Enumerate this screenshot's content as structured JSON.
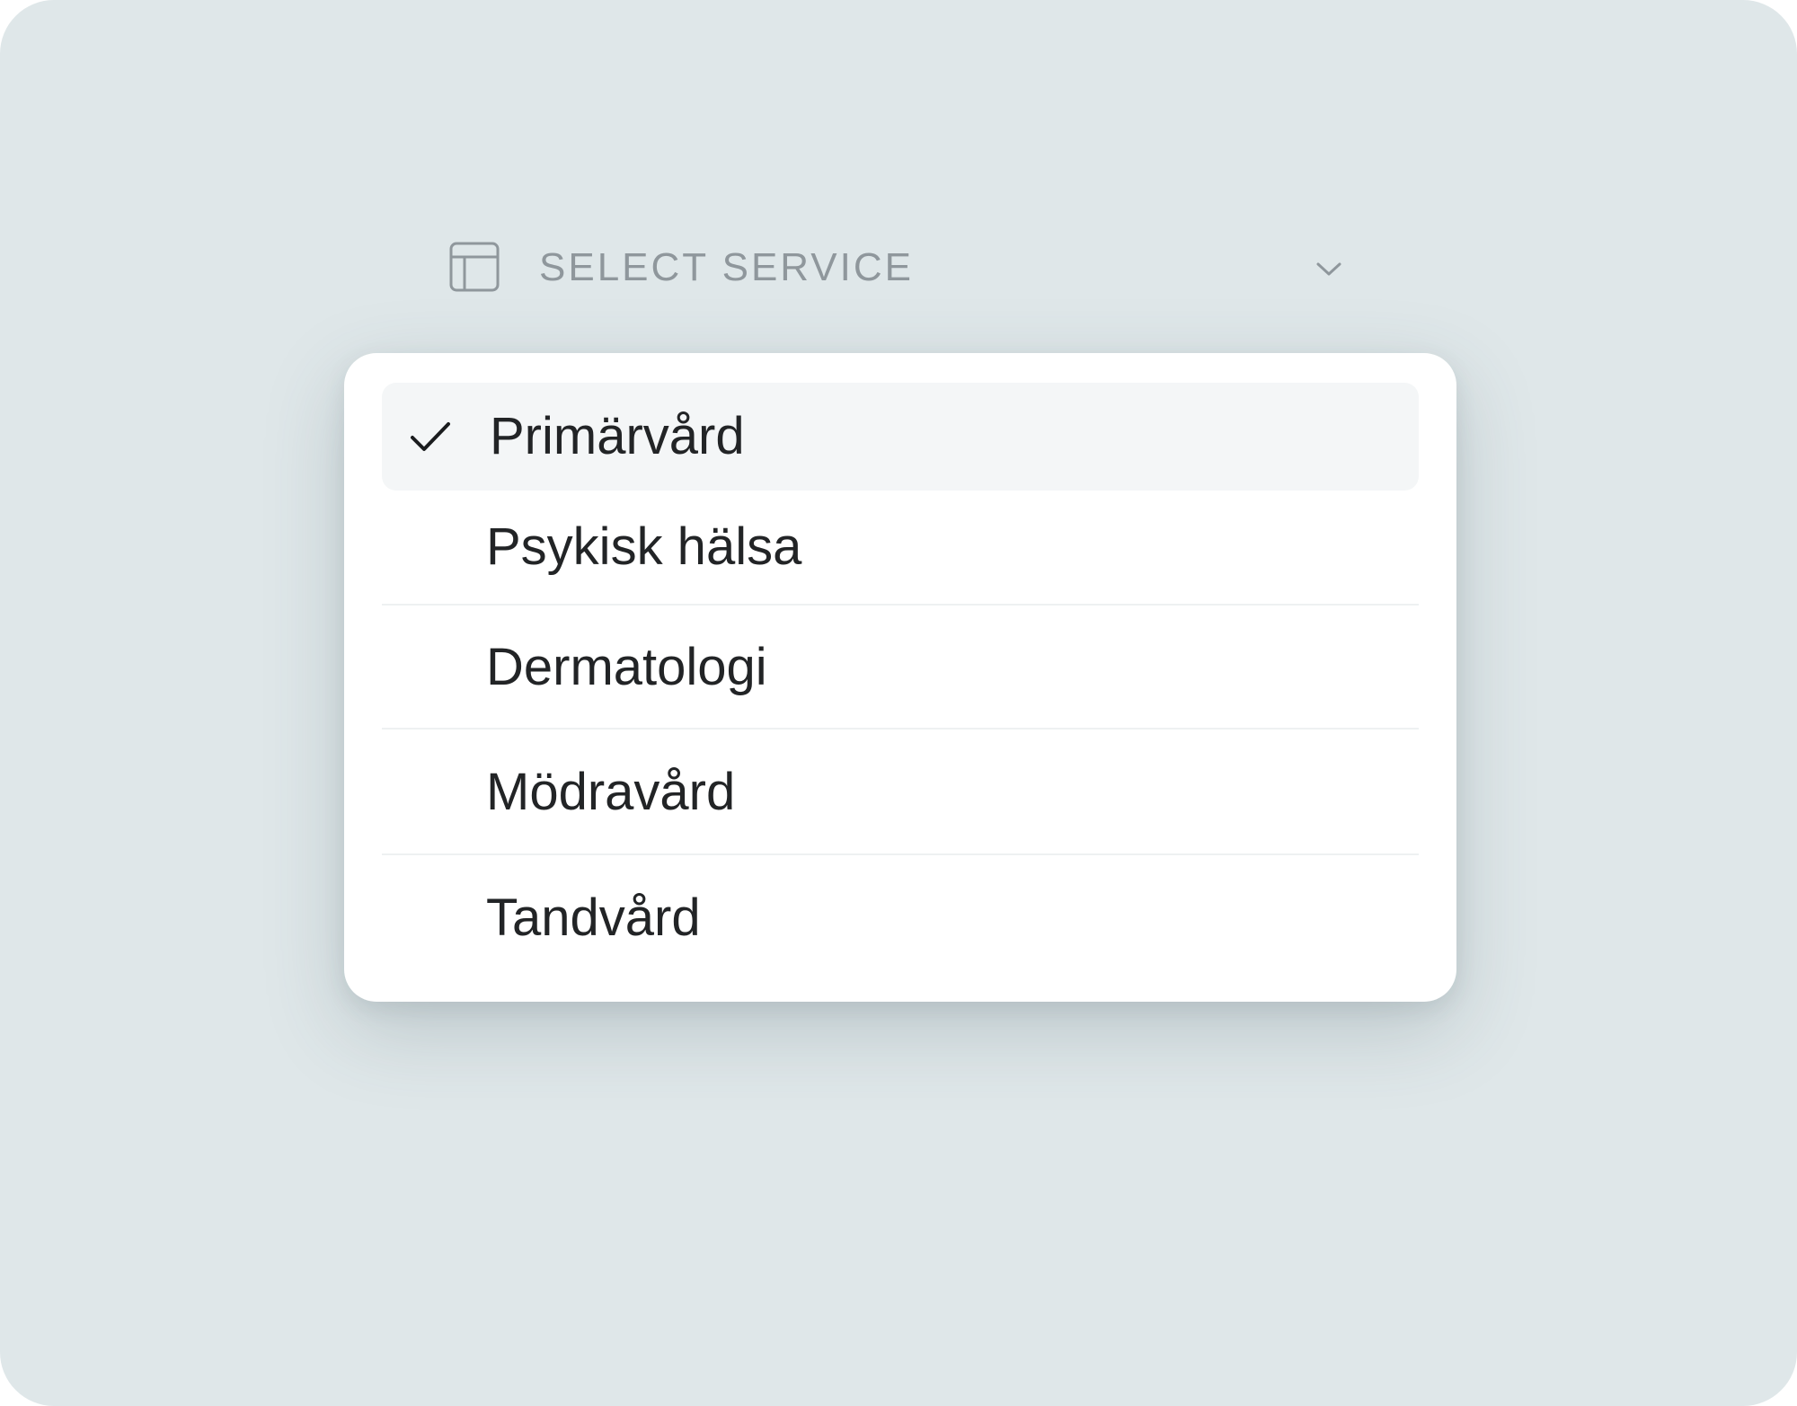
{
  "select": {
    "placeholder": "SELECT SERVICE",
    "icon": "table-layout-icon",
    "chevron": "chevron-down-icon",
    "selected_value": "Primärvård"
  },
  "options": [
    {
      "label": "Primärvård",
      "selected": true
    },
    {
      "label": "Psykisk hälsa",
      "selected": false
    },
    {
      "label": "Dermatologi",
      "selected": false
    },
    {
      "label": "Mödravård",
      "selected": false
    },
    {
      "label": "Tandvård",
      "selected": false
    }
  ],
  "colors": {
    "background": "#dfe7e9",
    "panel": "#ffffff",
    "selected_row": "#f4f6f7",
    "text": "#222426",
    "muted": "#8f979c"
  }
}
